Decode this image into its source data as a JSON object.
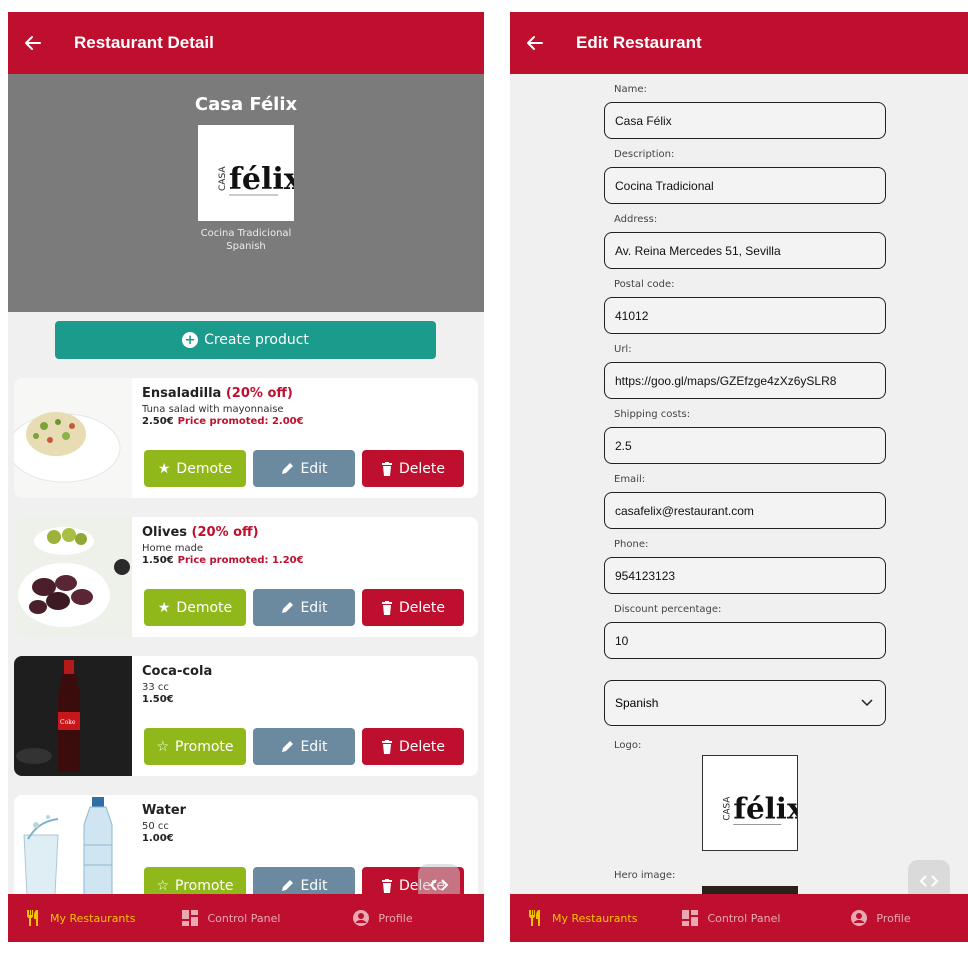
{
  "left": {
    "header": {
      "title": "Restaurant Detail"
    },
    "restaurant": {
      "name": "Casa Félix",
      "description": "Cocina Tradicional",
      "category": "Spanish"
    },
    "create_button": {
      "label": "Create product"
    },
    "products": [
      {
        "name": "Ensaladilla",
        "discount": "(20% off)",
        "description": "Tuna salad with mayonnaise",
        "price": "2.50€",
        "promoted_price": "Price promoted: 2.00€",
        "promote_label": "Demote",
        "promote_icon": "star-solid-icon",
        "thumb": "ensaladilla"
      },
      {
        "name": "Olives",
        "discount": "(20% off)",
        "description": "Home made",
        "price": "1.50€",
        "promoted_price": "Price promoted: 1.20€",
        "promote_label": "Demote",
        "promote_icon": "star-solid-icon",
        "thumb": "olives"
      },
      {
        "name": "Coca-cola",
        "discount": "",
        "description": "33 cc",
        "price": "1.50€",
        "promoted_price": "",
        "promote_label": "Promote",
        "promote_icon": "star-outline-icon",
        "thumb": "cocacola"
      },
      {
        "name": "Water",
        "discount": "",
        "description": "50 cc",
        "price": "1.00€",
        "promoted_price": "",
        "promote_label": "Promote",
        "promote_icon": "star-outline-icon",
        "thumb": "water"
      }
    ],
    "edit_label": "Edit",
    "delete_label": "Delete"
  },
  "right": {
    "header": {
      "title": "Edit Restaurant"
    },
    "fields": [
      {
        "label": "Name:",
        "value": "Casa Félix"
      },
      {
        "label": "Description:",
        "value": "Cocina Tradicional"
      },
      {
        "label": "Address:",
        "value": "Av. Reina Mercedes 51, Sevilla"
      },
      {
        "label": "Postal code:",
        "value": "41012"
      },
      {
        "label": "Url:",
        "value": "https://goo.gl/maps/GZEfzge4zXz6ySLR8"
      },
      {
        "label": "Shipping costs:",
        "value": "2.5"
      },
      {
        "label": "Email:",
        "value": "casafelix@restaurant.com"
      },
      {
        "label": "Phone:",
        "value": "954123123"
      },
      {
        "label": "Discount percentage:",
        "value": "10"
      }
    ],
    "category_select": {
      "value": "Spanish"
    },
    "logo_label": "Logo:",
    "hero_label": "Hero image:"
  },
  "tabbar": {
    "items": [
      {
        "label": "My Restaurants",
        "icon": "utensils-icon",
        "active": true
      },
      {
        "label": "Control Panel",
        "icon": "dashboard-icon",
        "active": false
      },
      {
        "label": "Profile",
        "icon": "user-circle-icon",
        "active": false
      }
    ]
  },
  "logo": {
    "text": "félix",
    "vertical_text": "CASA"
  },
  "colors": {
    "primary": "#be0f2e",
    "teal": "#1a9b8c",
    "green": "#91b81b",
    "slate": "#6b8aa0",
    "tab_active": "#f5c400",
    "hero_bg": "#7b7b7b"
  }
}
